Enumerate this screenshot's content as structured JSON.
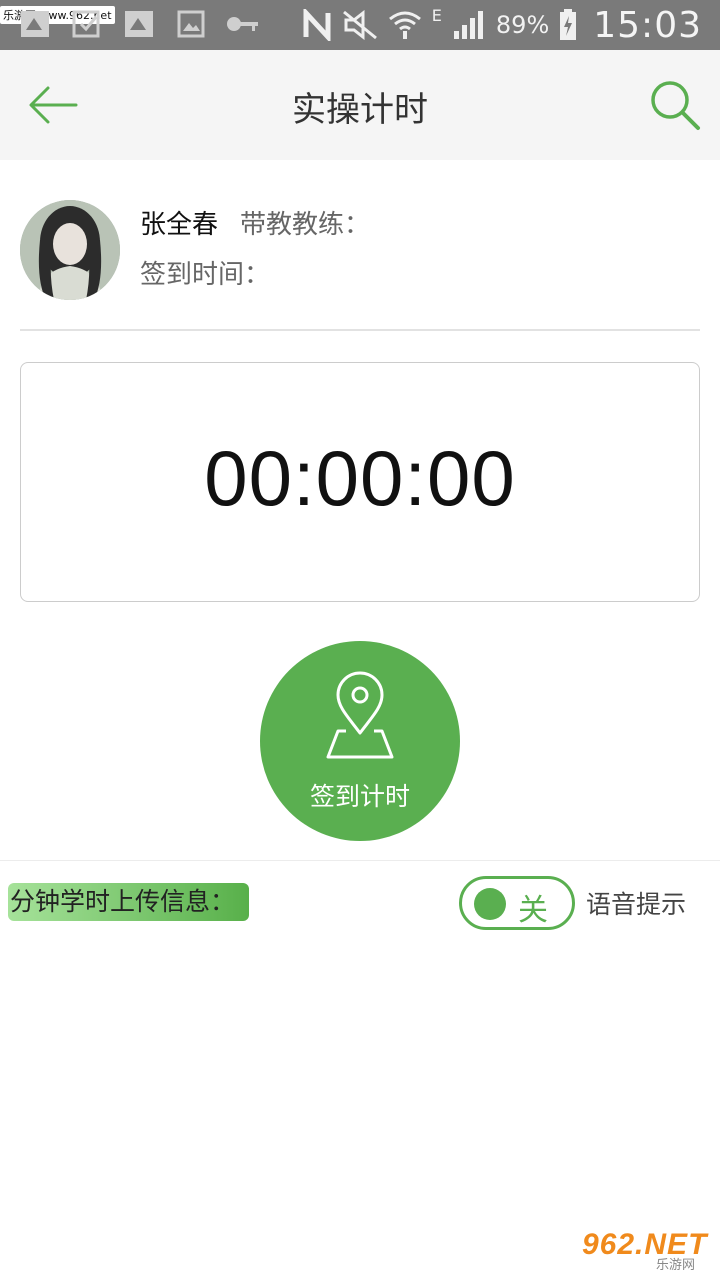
{
  "status_bar": {
    "watermark": "乐游网 www.962.net",
    "network_letter": "E",
    "battery_percent": "89%",
    "clock": "15:03"
  },
  "header": {
    "title": "实操计时",
    "back_icon": "arrow-left-icon",
    "search_icon": "search-icon"
  },
  "profile": {
    "name": "张全春",
    "coach_label": "带教教练：",
    "checkin_time_label": "签到时间："
  },
  "timer": {
    "value": "00:00:00"
  },
  "checkin_button": {
    "label": "签到计时",
    "icon": "map-pin-icon"
  },
  "bottom": {
    "upload_info_label": "分钟学时上传信息：",
    "voice_toggle_state": "关",
    "voice_label": "语音提示"
  },
  "watermark": {
    "main": "962.NET",
    "sub": "乐游网"
  },
  "colors": {
    "accent": "#5aaf50",
    "header_bg": "#f5f5f5",
    "status_bar_bg": "#7a7a7a"
  }
}
